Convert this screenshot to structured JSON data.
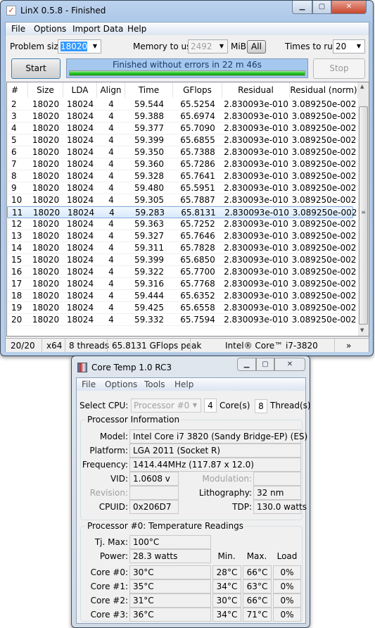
{
  "linx": {
    "title": "LinX 0.5.8 - Finished",
    "menu": [
      "File",
      "Options",
      "Import Data",
      "Help"
    ],
    "problem_size_label": "Problem size:",
    "problem_size": "18020",
    "memory_label": "Memory to use:",
    "memory": "2492",
    "memory_unit": "MiB",
    "all_button": "All",
    "times_label": "Times to run:",
    "times": "20",
    "start_button": "Start",
    "stop_button": "Stop",
    "progress_text": "Finished without errors in 22 m 46s",
    "progress_percent": 100,
    "progress_color": "#22c322",
    "columns": [
      "#",
      "Size",
      "LDA",
      "Align",
      "Time",
      "GFlops",
      "Residual",
      "Residual (norm)"
    ],
    "rows": [
      [
        "2",
        "18020",
        "18024",
        "4",
        "59.544",
        "65.5254",
        "2.830093e-010",
        "3.089250e-002"
      ],
      [
        "3",
        "18020",
        "18024",
        "4",
        "59.388",
        "65.6974",
        "2.830093e-010",
        "3.089250e-002"
      ],
      [
        "4",
        "18020",
        "18024",
        "4",
        "59.377",
        "65.7090",
        "2.830093e-010",
        "3.089250e-002"
      ],
      [
        "5",
        "18020",
        "18024",
        "4",
        "59.399",
        "65.6855",
        "2.830093e-010",
        "3.089250e-002"
      ],
      [
        "6",
        "18020",
        "18024",
        "4",
        "59.350",
        "65.7388",
        "2.830093e-010",
        "3.089250e-002"
      ],
      [
        "7",
        "18020",
        "18024",
        "4",
        "59.360",
        "65.7286",
        "2.830093e-010",
        "3.089250e-002"
      ],
      [
        "8",
        "18020",
        "18024",
        "4",
        "59.328",
        "65.7641",
        "2.830093e-010",
        "3.089250e-002"
      ],
      [
        "9",
        "18020",
        "18024",
        "4",
        "59.480",
        "65.5951",
        "2.830093e-010",
        "3.089250e-002"
      ],
      [
        "10",
        "18020",
        "18024",
        "4",
        "59.305",
        "65.7887",
        "2.830093e-010",
        "3.089250e-002"
      ],
      [
        "11",
        "18020",
        "18024",
        "4",
        "59.283",
        "65.8131",
        "2.830093e-010",
        "3.089250e-002"
      ],
      [
        "12",
        "18020",
        "18024",
        "4",
        "59.363",
        "65.7252",
        "2.830093e-010",
        "3.089250e-002"
      ],
      [
        "13",
        "18020",
        "18024",
        "4",
        "59.327",
        "65.7646",
        "2.830093e-010",
        "3.089250e-002"
      ],
      [
        "14",
        "18020",
        "18024",
        "4",
        "59.311",
        "65.7828",
        "2.830093e-010",
        "3.089250e-002"
      ],
      [
        "15",
        "18020",
        "18024",
        "4",
        "59.399",
        "65.6850",
        "2.830093e-010",
        "3.089250e-002"
      ],
      [
        "16",
        "18020",
        "18024",
        "4",
        "59.322",
        "65.7700",
        "2.830093e-010",
        "3.089250e-002"
      ],
      [
        "17",
        "18020",
        "18024",
        "4",
        "59.316",
        "65.7768",
        "2.830093e-010",
        "3.089250e-002"
      ],
      [
        "18",
        "18020",
        "18024",
        "4",
        "59.444",
        "65.6352",
        "2.830093e-010",
        "3.089250e-002"
      ],
      [
        "19",
        "18020",
        "18024",
        "4",
        "59.425",
        "65.6558",
        "2.830093e-010",
        "3.089250e-002"
      ],
      [
        "20",
        "18020",
        "18024",
        "4",
        "59.332",
        "65.7594",
        "2.830093e-010",
        "3.089250e-002"
      ]
    ],
    "selected_row": "11",
    "status": {
      "runs": "20/20",
      "arch": "x64",
      "threads": "8 threads",
      "peak": "65.8131 GFlops peak",
      "cpu": "Intel® Core™ i7-3820",
      "more": "»"
    }
  },
  "coretemp": {
    "title": "Core Temp 1.0 RC3",
    "menu": [
      "File",
      "Options",
      "Tools",
      "Help"
    ],
    "select_cpu_label": "Select CPU:",
    "select_cpu": "Processor #0",
    "cores": "4",
    "cores_label": "Core(s)",
    "threads": "8",
    "threads_label": "Thread(s)",
    "info_title": "Processor Information",
    "model_label": "Model:",
    "model": "Intel Core i7 3820 (Sandy Bridge-EP)  (ES)",
    "platform_label": "Platform:",
    "platform": "LGA 2011 (Socket R)",
    "frequency_label": "Frequency:",
    "frequency": "1414.44MHz (117.87 x 12.0)",
    "vid_label": "VID:",
    "vid": "1.0608 v",
    "modulation_label": "Modulation:",
    "modulation": "",
    "revision_label": "Revision:",
    "revision": "",
    "lithography_label": "Lithography:",
    "lithography": "32 nm",
    "cpuid_label": "CPUID:",
    "cpuid": "0x206D7",
    "tdp_label": "TDP:",
    "tdp": "130.0 watts",
    "temp_title": "Processor #0: Temperature Readings",
    "tjmax_label": "Tj. Max:",
    "tjmax": "100°C",
    "power_label": "Power:",
    "power": "28.3 watts",
    "min_label": "Min.",
    "max_label": "Max.",
    "load_label": "Load",
    "cores_list": [
      {
        "label": "Core #0:",
        "temp": "30°C",
        "min": "28°C",
        "max": "66°C",
        "load": "0%"
      },
      {
        "label": "Core #1:",
        "temp": "35°C",
        "min": "34°C",
        "max": "63°C",
        "load": "0%"
      },
      {
        "label": "Core #2:",
        "temp": "31°C",
        "min": "30°C",
        "max": "66°C",
        "load": "0%"
      },
      {
        "label": "Core #3:",
        "temp": "36°C",
        "min": "34°C",
        "max": "71°C",
        "load": "0%"
      }
    ]
  }
}
